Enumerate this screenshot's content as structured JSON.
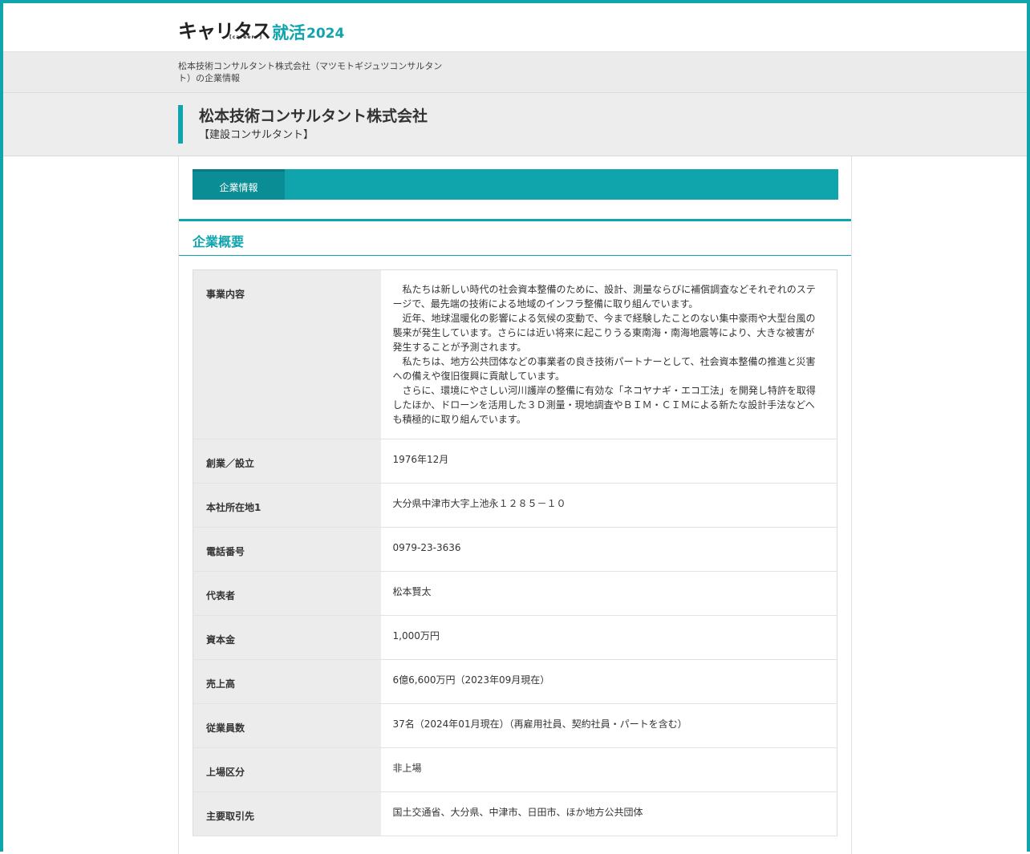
{
  "logo": {
    "main": "キャリタス",
    "sub": "[career+]",
    "job": "就活",
    "year": "2024"
  },
  "breadcrumb": "松本技術コンサルタント株式会社（マツモトギジュツコンサルタント）の企業情報",
  "company": {
    "name": "松本技術コンサルタント株式会社",
    "category": "【建設コンサルタント】"
  },
  "tabs": [
    {
      "label": "企業情報",
      "active": true
    }
  ],
  "section_title": "企業概要",
  "business": {
    "label": "事業内容",
    "paragraphs": [
      "私たちは新しい時代の社会資本整備のために、設計、測量ならびに補償調査などそれぞれのステージで、最先端の技術による地域のインフラ整備に取り組んでいます。",
      "近年、地球温暖化の影響による気候の変動で、今まで経験したことのない集中豪雨や大型台風の襲来が発生しています。さらには近い将来に起こりうる東南海・南海地震等により、大きな被害が発生することが予測されます。",
      "私たちは、地方公共団体などの事業者の良き技術パートナーとして、社会資本整備の推進と災害への備えや復旧復興に貢献しています。",
      "さらに、環境にやさしい河川護岸の整備に有効な「ネコヤナギ・エコ工法」を開発し特許を取得したほか、ドローンを活用した３Ｄ測量・現地調査やＢＩＭ・ＣＩＭによる新たな設計手法などへも積極的に取り組んでいます。"
    ]
  },
  "rows": [
    {
      "label": "創業／設立",
      "value": "1976年12月"
    },
    {
      "label": "本社所在地1",
      "value": "大分県中津市大字上池永１２８５－１０"
    },
    {
      "label": "電話番号",
      "value": "0979-23-3636"
    },
    {
      "label": "代表者",
      "value": "松本賢太"
    },
    {
      "label": "資本金",
      "value": "1,000万円"
    },
    {
      "label": "売上高",
      "value": "6億6,600万円（2023年09月現在）"
    },
    {
      "label": "従業員数",
      "value": "37名（2024年01月現在）（再雇用社員、契約社員・パートを含む）"
    },
    {
      "label": "上場区分",
      "value": "非上場"
    },
    {
      "label": "主要取引先",
      "value": "国土交通省、大分県、中津市、日田市、ほか地方公共団体"
    }
  ],
  "colors": {
    "accent": "#10a4ad",
    "accent_dark": "#0b8d96",
    "band": "#ebebeb"
  }
}
